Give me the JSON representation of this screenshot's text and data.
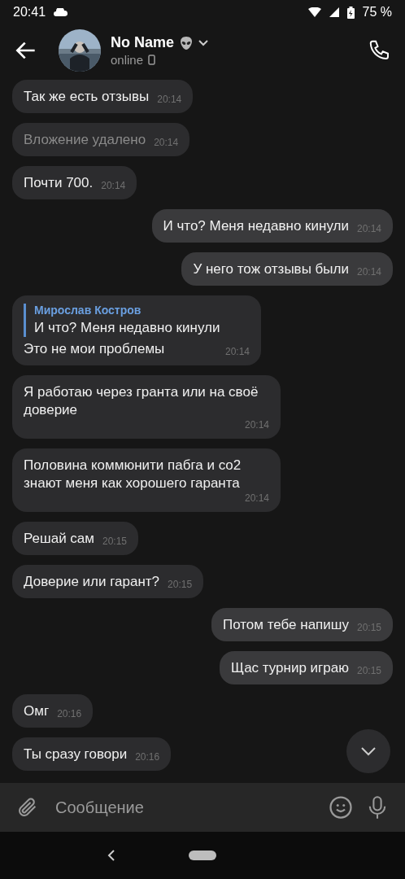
{
  "status_bar": {
    "time": "20:41",
    "battery": "75 %"
  },
  "header": {
    "name": "No Name",
    "status": "online"
  },
  "messages": [
    {
      "kind": "text",
      "outgoing": false,
      "text": "Так же есть отзывы",
      "time": "20:14"
    },
    {
      "kind": "deleted",
      "outgoing": false,
      "text": "Вложение удалено",
      "time": "20:14"
    },
    {
      "kind": "text",
      "outgoing": false,
      "text": "Почти 700.",
      "time": "20:14"
    },
    {
      "kind": "text",
      "outgoing": true,
      "text": "И что? Меня недавно кинули",
      "time": "20:14"
    },
    {
      "kind": "text",
      "outgoing": true,
      "text": "У него тож отзывы были",
      "time": "20:14"
    },
    {
      "kind": "reply",
      "outgoing": false,
      "quote_author": "Мирослав Костров",
      "quote_text": "И что? Меня недавно кинули",
      "text": "Это не мои проблемы",
      "time": "20:14"
    },
    {
      "kind": "text",
      "outgoing": false,
      "text": "Я работаю через гранта или на своё доверие",
      "time": "20:14"
    },
    {
      "kind": "text",
      "outgoing": false,
      "text": "Половина коммюнити пабга и со2 знают меня как хорошего гаранта",
      "time": "20:14"
    },
    {
      "kind": "text",
      "outgoing": false,
      "text": "Решай сам",
      "time": "20:15"
    },
    {
      "kind": "text",
      "outgoing": false,
      "text": "Доверие или гарант?",
      "time": "20:15"
    },
    {
      "kind": "text",
      "outgoing": true,
      "text": "Потом тебе напишу",
      "time": "20:15"
    },
    {
      "kind": "text",
      "outgoing": true,
      "text": "Щас турнир играю",
      "time": "20:15"
    },
    {
      "kind": "text",
      "outgoing": false,
      "text": "Омг",
      "time": "20:16"
    },
    {
      "kind": "text",
      "outgoing": false,
      "text": "Ты сразу говори",
      "time": "20:16"
    }
  ],
  "composer": {
    "placeholder": "Сообщение"
  }
}
